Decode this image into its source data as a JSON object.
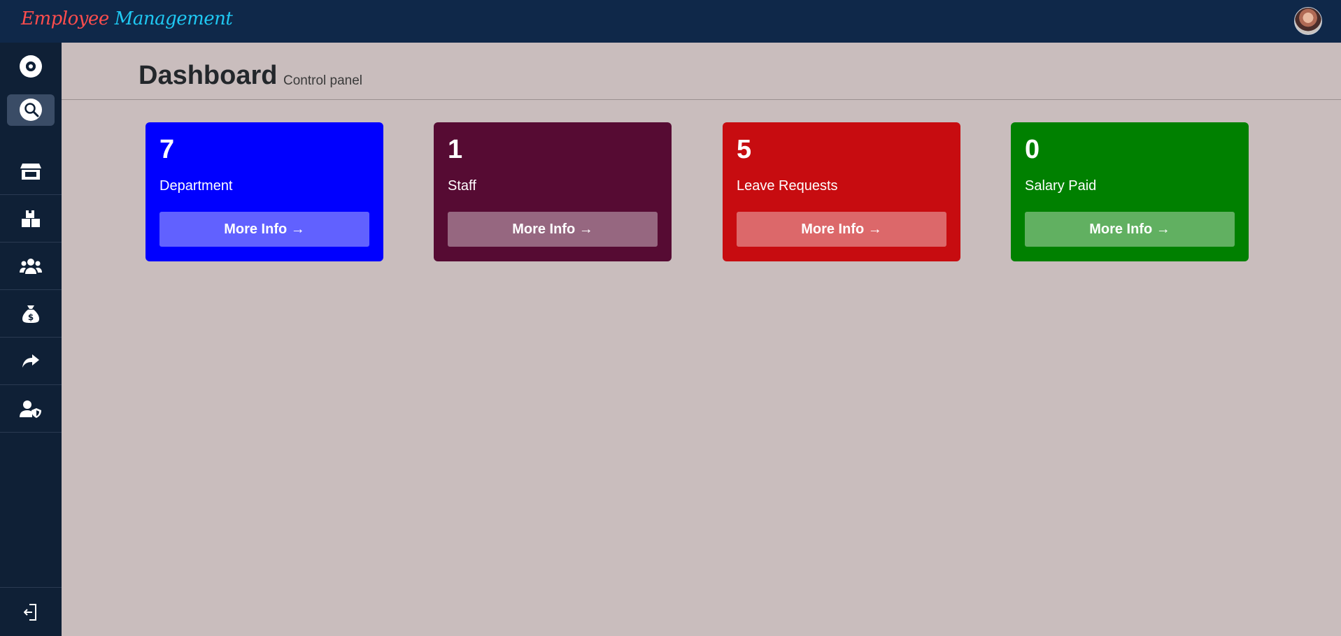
{
  "app": {
    "brand_first": "Employee",
    "brand_second": "Management"
  },
  "header": {
    "title": "Dashboard",
    "subtitle": "Control panel"
  },
  "colors": {
    "topbar": "#0f2849",
    "sidebar": "#0f2036",
    "background": "#c9bdbd",
    "brand_first": "#ff4d4d",
    "brand_second": "#1fc8f2"
  },
  "sidebar": {
    "logo_icon": "eye-icon",
    "search_icon": "search-icon",
    "items": [
      {
        "icon": "store-icon"
      },
      {
        "icon": "boxes-icon"
      },
      {
        "icon": "users-icon"
      },
      {
        "icon": "money-bag-icon"
      },
      {
        "icon": "share-arrow-icon"
      },
      {
        "icon": "user-shield-icon"
      }
    ],
    "logout_icon": "logout-icon"
  },
  "cards": [
    {
      "value": "7",
      "label": "Department",
      "button": "More Info →",
      "color": "#0000ff"
    },
    {
      "value": "1",
      "label": "Staff",
      "button": "More Info →",
      "color": "#560b33"
    },
    {
      "value": "5",
      "label": "Leave Requests",
      "button": "More Info →",
      "color": "#c70c10"
    },
    {
      "value": "0",
      "label": "Salary Paid",
      "button": "More Info →",
      "color": "#008000"
    }
  ]
}
